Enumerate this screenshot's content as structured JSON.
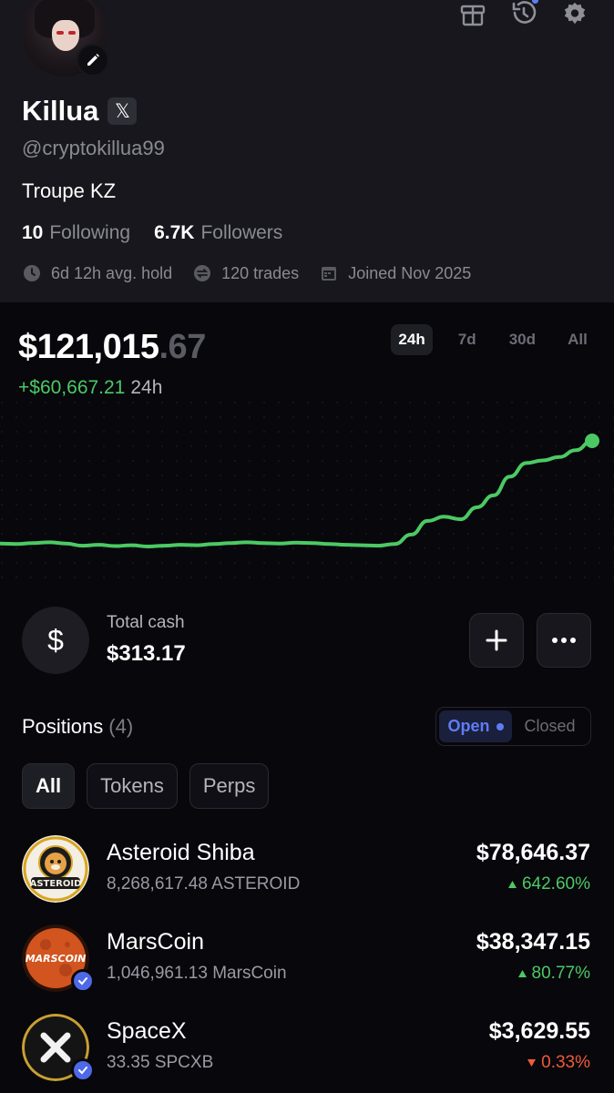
{
  "profile": {
    "name": "Killua",
    "x_badge": "𝕏",
    "handle": "@cryptokillua99",
    "bio": "Troupe KZ",
    "following_count": "10",
    "following_label": "Following",
    "followers_count": "6.7K",
    "followers_label": "Followers",
    "avg_hold": "6d 12h avg. hold",
    "trades": "120 trades",
    "joined": "Joined Nov 2025"
  },
  "header_icons": [
    "gift-icon",
    "history-icon",
    "settings-icon"
  ],
  "portfolio": {
    "balance_main": "$121,015",
    "balance_cents": ".67",
    "pnl_value": "+$60,667.21",
    "pnl_period": "24h",
    "ranges": [
      "24h",
      "7d",
      "30d",
      "All"
    ],
    "active_range": "24h"
  },
  "chart_data": {
    "type": "line",
    "color": "#4cc964",
    "values": [
      60.35,
      60.3,
      60.4,
      60.5,
      60.35,
      60.1,
      60.2,
      60.05,
      60.15,
      60.0,
      60.1,
      60.2,
      60.15,
      60.3,
      60.4,
      60.5,
      60.4,
      60.35,
      60.45,
      60.4,
      60.3,
      60.2,
      60.15,
      60.1,
      60.3,
      61.4,
      63.0,
      63.5,
      63.2,
      64.6,
      66.0,
      68.2,
      69.8,
      70.1,
      70.5,
      71.3,
      72.4
    ]
  },
  "cash": {
    "icon_symbol": "$",
    "label": "Total cash",
    "value": "$313.17"
  },
  "positions": {
    "title": "Positions",
    "count": "(4)",
    "toggle_open": "Open",
    "toggle_closed": "Closed",
    "filters": [
      "All",
      "Tokens",
      "Perps"
    ],
    "active_filter": "All",
    "items": [
      {
        "name": "Asteroid Shiba",
        "amount": "8,268,617.48 ASTEROID",
        "value": "$78,646.37",
        "change": "642.60%",
        "direction": "up"
      },
      {
        "name": "MarsCoin",
        "amount": "1,046,961.13 MarsCoin",
        "value": "$38,347.15",
        "change": "80.77%",
        "direction": "up"
      },
      {
        "name": "SpaceX",
        "amount": "33.35 SPCXB",
        "value": "$3,629.55",
        "change": "0.33%",
        "direction": "down"
      }
    ]
  },
  "token_logo_text": {
    "asteroid": "ASTEROID",
    "marscoin": "MARSCOIN"
  }
}
